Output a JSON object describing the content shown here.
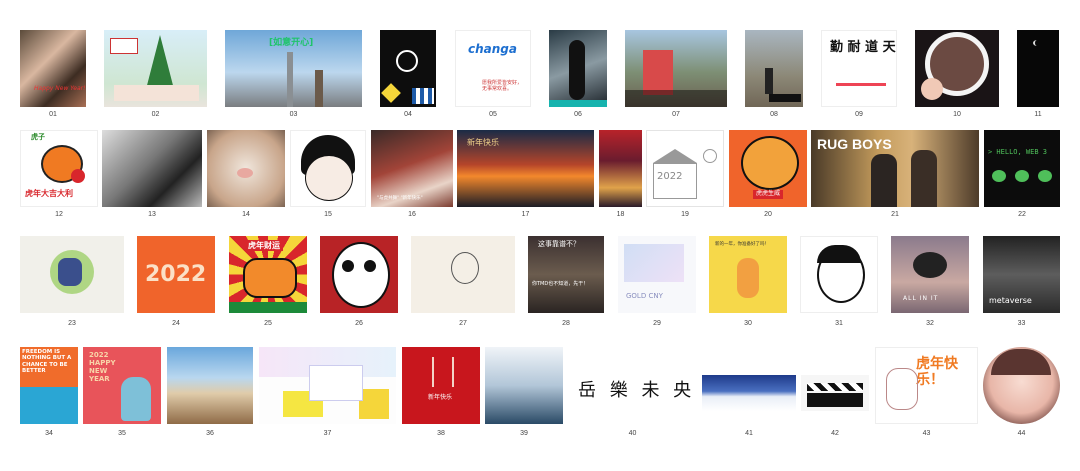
{
  "grid": {
    "numbers": [
      "01",
      "02",
      "03",
      "04",
      "05",
      "06",
      "07",
      "08",
      "09",
      "10",
      "11",
      "12",
      "13",
      "14",
      "15",
      "16",
      "17",
      "18",
      "19",
      "20",
      "21",
      "22",
      "23",
      "24",
      "25",
      "26",
      "27",
      "28",
      "29",
      "30",
      "31",
      "32",
      "33",
      "34",
      "35",
      "36",
      "37",
      "38",
      "39",
      "40",
      "41",
      "42",
      "43",
      "44"
    ]
  },
  "captions": {
    "t01": "Happy New Year!",
    "t02": "",
    "t03": "[如意开心]",
    "t05_logo": "changa",
    "t05_text": "愿我所爱皆安好，\n无事常欢喜。",
    "t06": "",
    "t08": "",
    "t09": "勤 耐 道 天",
    "t10": "",
    "t12_top": "虎子",
    "t12_bottom": "虎年大吉大利",
    "t16": "\"与虎共舞\" \"新年快乐\"",
    "t17": "新年快乐",
    "t19": "2022",
    "t20": "虎虎生威",
    "t21_title": "RUG BOYS",
    "t22": "> HELLO, WEB 3",
    "t24": "2022",
    "t25": "虎年财运",
    "t28": "这事靠谱不？",
    "t28b": "你TMD也不知道，先干！",
    "t29": "GOLD CNY",
    "t30": "新的一年，你准备好了吗！",
    "t32": "ALL IN IT",
    "t33": "metaverse",
    "t34": "FREEDOM IS NOTHING BUT A CHANCE TO BE BETTER",
    "t35": "2022 HAPPY NEW YEAR",
    "t38": "新年快乐",
    "t40": "岳 樂 未 央",
    "t43": "虎年快乐！"
  },
  "colors": {
    "red": "#d8262c",
    "orange": "#f06c2b",
    "yellow": "#f5d63a",
    "dark": "#111111",
    "green": "#4fbf5a"
  }
}
